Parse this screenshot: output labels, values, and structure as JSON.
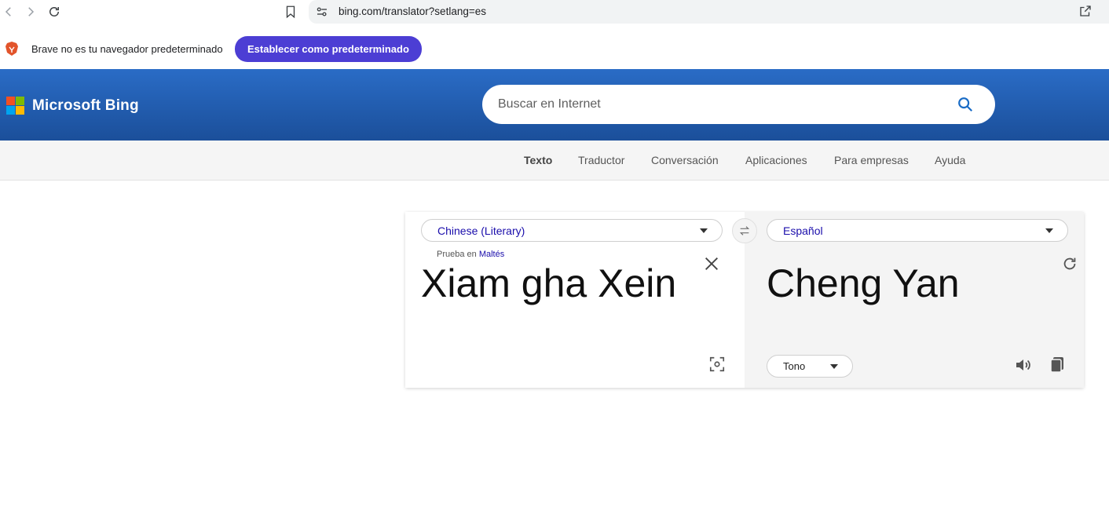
{
  "browser": {
    "url": "bing.com/translator?setlang=es"
  },
  "notice": {
    "message": "Brave no es tu navegador predeterminado",
    "button_label": "Establecer como predeterminado"
  },
  "header": {
    "brand": "Microsoft Bing",
    "search_placeholder": "Buscar en Internet",
    "logo_colors": [
      "#f25022",
      "#7fba00",
      "#00a4ef",
      "#ffb900"
    ]
  },
  "sub_nav": {
    "items": [
      {
        "label": "Texto",
        "active": true
      },
      {
        "label": "Traductor",
        "active": false
      },
      {
        "label": "Conversación",
        "active": false
      },
      {
        "label": "Aplicaciones",
        "active": false
      },
      {
        "label": "Para empresas",
        "active": false
      },
      {
        "label": "Ayuda",
        "active": false
      }
    ]
  },
  "translator": {
    "source_language": "Chinese (Literary)",
    "target_language": "Español",
    "hint_prefix": "Prueba en",
    "hint_link": "Maltés",
    "source_text": "Xiam gha Xein",
    "target_text": "Cheng Yan",
    "tone_label": "Tono"
  },
  "colors": {
    "header_blue": "#2a6cc6",
    "notice_button": "#4c3ed4",
    "link": "#1a0dab"
  }
}
